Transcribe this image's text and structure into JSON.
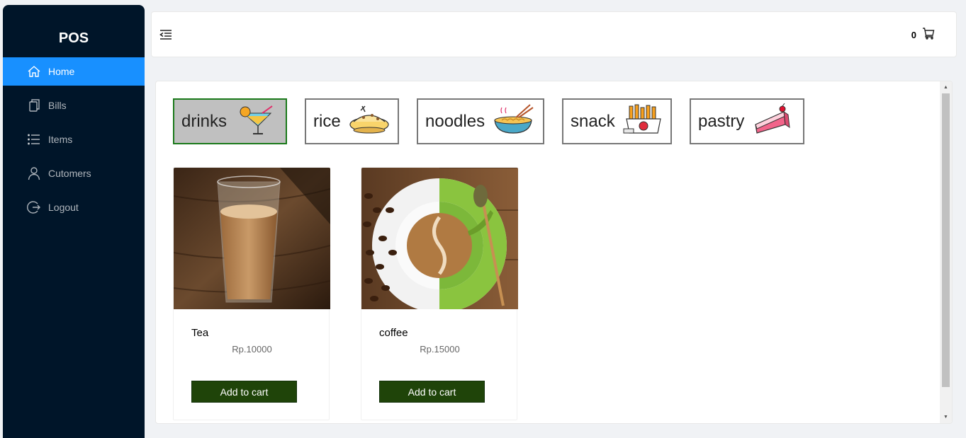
{
  "app": {
    "title": "POS"
  },
  "sidebar": {
    "items": [
      {
        "label": "Home",
        "icon": "home-icon"
      },
      {
        "label": "Bills",
        "icon": "copy-icon"
      },
      {
        "label": "Items",
        "icon": "list-icon"
      },
      {
        "label": "Cutomers",
        "icon": "user-icon"
      },
      {
        "label": "Logout",
        "icon": "logout-icon"
      }
    ],
    "active_index": 0,
    "colors": {
      "background": "#001529",
      "active": "#1890ff"
    }
  },
  "header": {
    "fold_icon": "menu-fold-icon",
    "cart": {
      "count": "0",
      "icon": "shopping-cart-icon"
    }
  },
  "categories": [
    {
      "label": "drinks",
      "icon": "cocktail-icon",
      "active": true
    },
    {
      "label": "rice",
      "icon": "rice-dish-icon",
      "active": false
    },
    {
      "label": "noodles",
      "icon": "noodle-bowl-icon",
      "active": false
    },
    {
      "label": "snack",
      "icon": "fries-box-icon",
      "active": false
    },
    {
      "label": "pastry",
      "icon": "cake-slice-icon",
      "active": false
    }
  ],
  "products": [
    {
      "name": "Tea",
      "price": "Rp.10000",
      "button": "Add to cart",
      "image": "tea-glass-photo"
    },
    {
      "name": "coffee",
      "price": "Rp.15000",
      "button": "Add to cart",
      "image": "coffee-cup-photo"
    }
  ],
  "colors": {
    "button": "#1f4409",
    "active_category_border": "#1a7a1a"
  }
}
